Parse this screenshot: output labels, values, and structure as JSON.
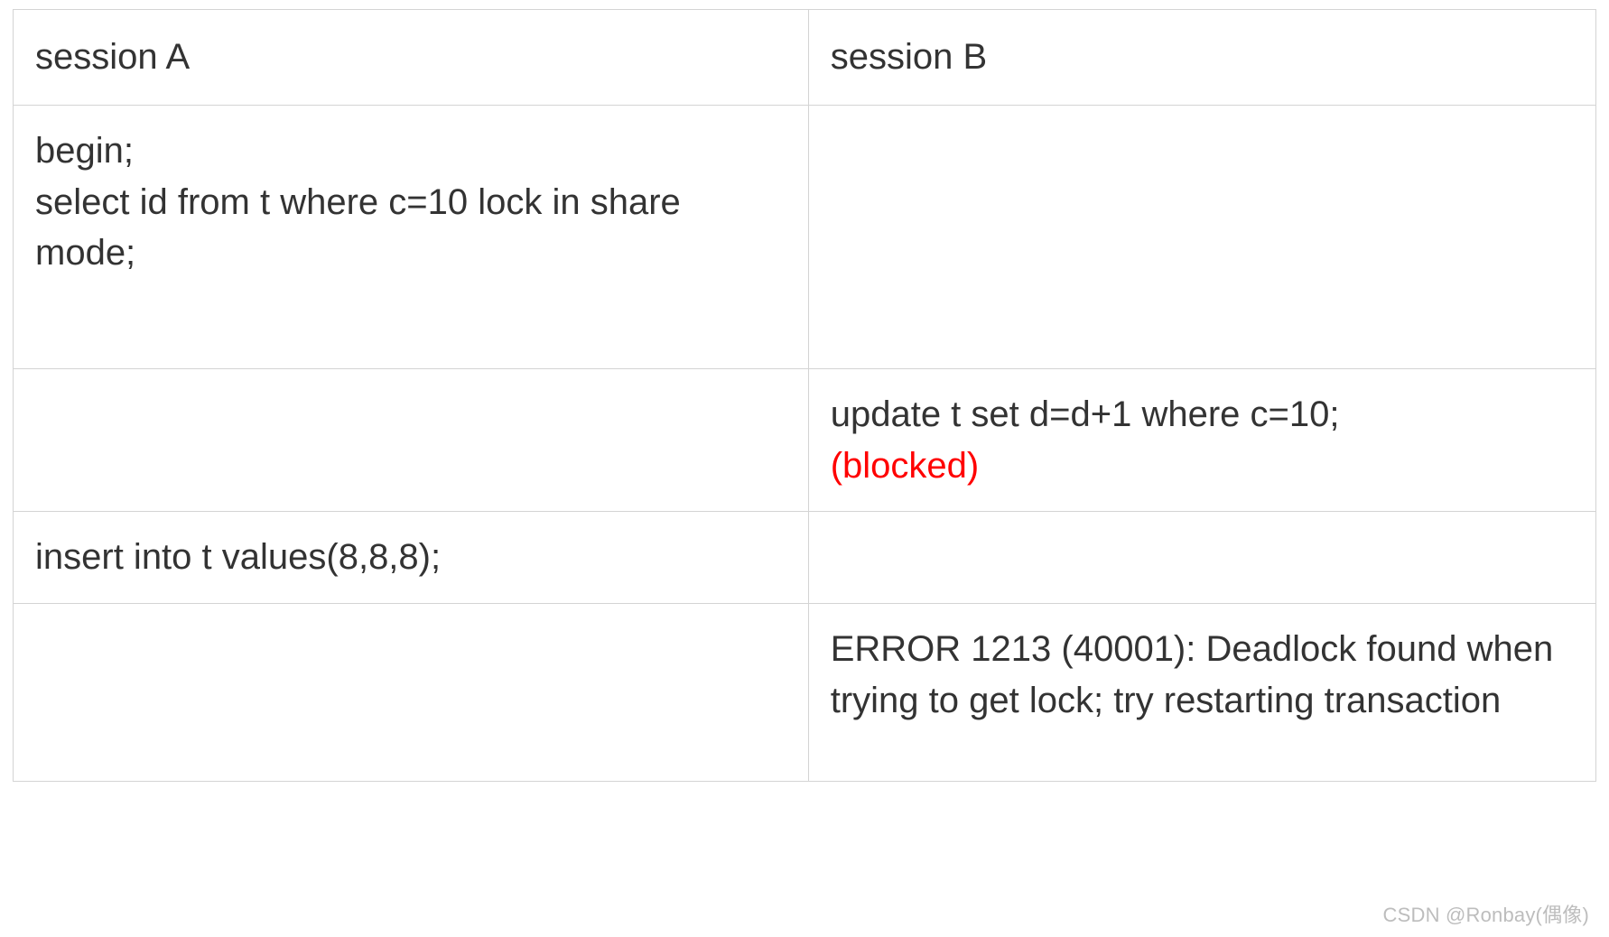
{
  "table": {
    "headers": {
      "col_a": "session A",
      "col_b": "session B"
    },
    "rows": [
      {
        "a": "begin;\nselect id from t where c=10 lock in share mode;",
        "b": ""
      },
      {
        "a": "",
        "b_line1": "update t set d=d+1 where c=10;",
        "b_blocked": "(blocked)"
      },
      {
        "a": "insert into t values(8,8,8);",
        "b": ""
      },
      {
        "a": "",
        "b": "ERROR 1213 (40001): Deadlock found when trying to get lock; try restarting transaction"
      }
    ]
  },
  "watermark": "CSDN @Ronbay(偶像)"
}
